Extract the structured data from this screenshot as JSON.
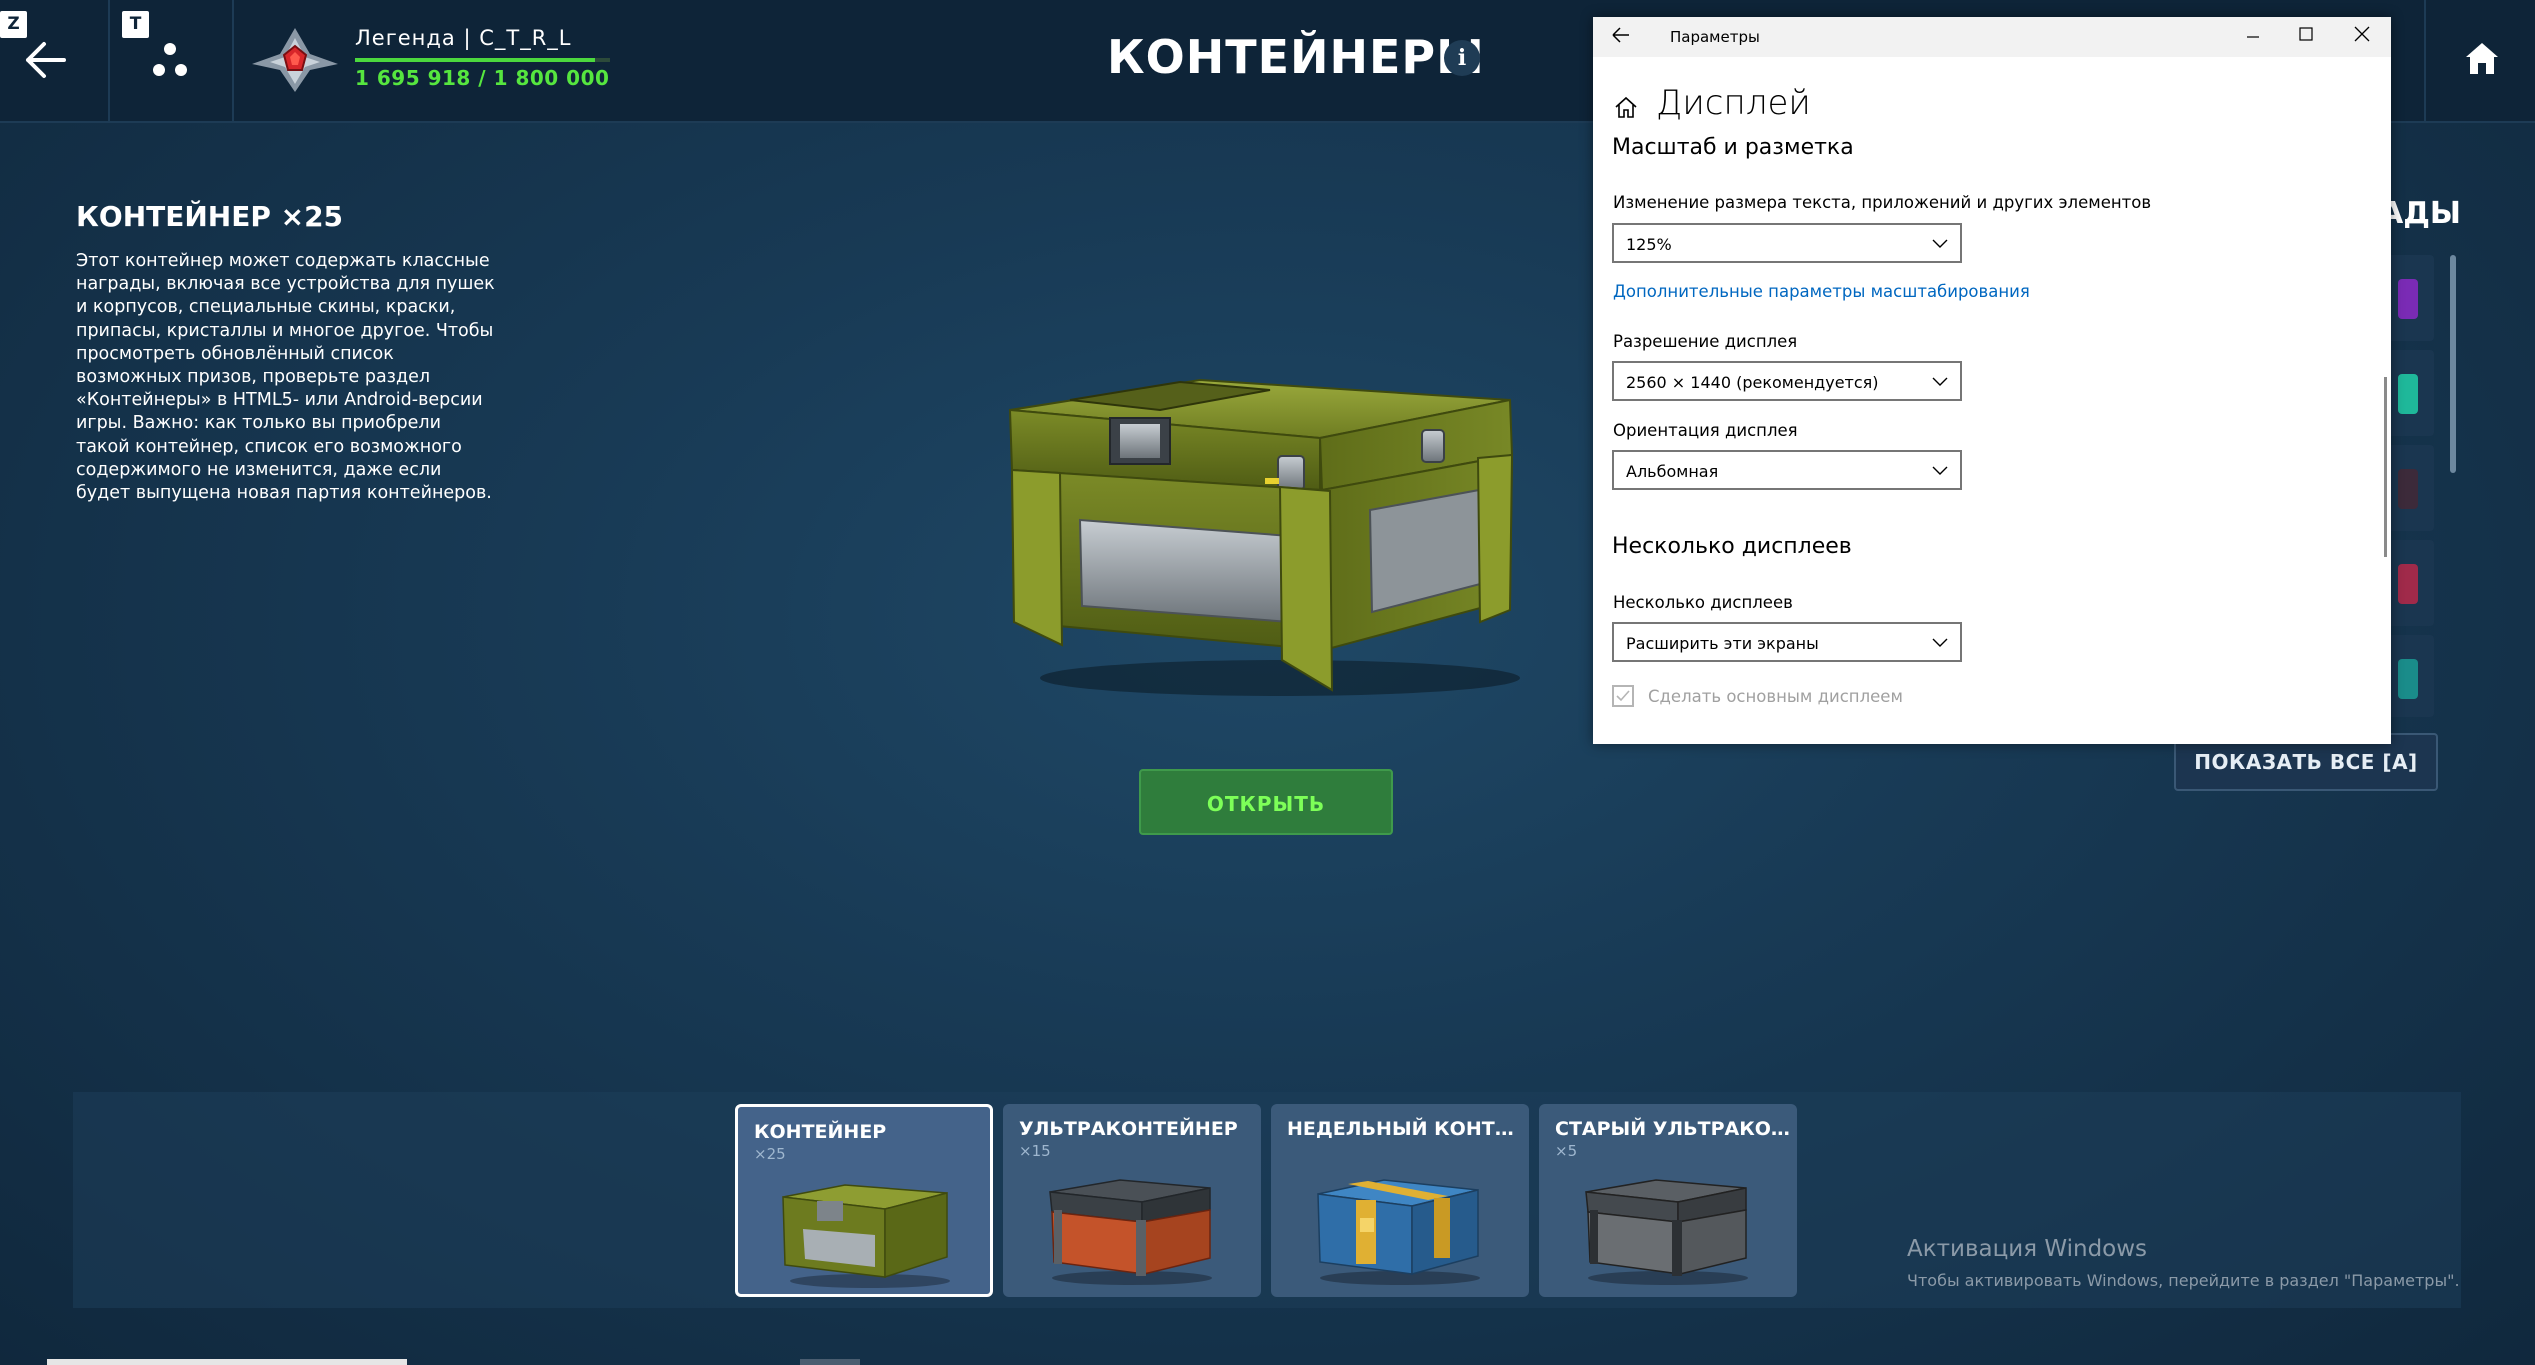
{
  "hotkeys": {
    "back": "Z",
    "social": "T"
  },
  "player": {
    "name": "Легенда | C_T_R_L",
    "xp_text": "1 695 918 / 1 800 000",
    "xp_current": 1695918,
    "xp_max": 1800000
  },
  "page": {
    "title": "КОНТЕЙНЕРЫ",
    "info": "i"
  },
  "container": {
    "title": "КОНТЕЙНЕР ×25",
    "description": "Этот контейнер может содержать классные награды, включая все устройства для пушек и корпусов, специальные скины, краски, припасы, кристаллы и многое другое. Чтобы просмотреть обновлённый список возможных призов, проверьте раздел «Контейнеры» в HTML5- или Android-версии игры. Важно: как только вы приобрели такой контейнер, список его возможного содержимого не изменится, даже если будет выпущена новая партия контейнеров.",
    "open_label": "ОТКРЫТЬ"
  },
  "rewards": {
    "title_visible": "АДЫ",
    "show_all_label": "ПОКАЗАТЬ ВСЕ [A]"
  },
  "cards": [
    {
      "name": "КОНТЕЙНЕР",
      "count": "×25",
      "selected": true
    },
    {
      "name": "УЛЬТРАКОНТЕЙНЕР",
      "count": "×15",
      "selected": false
    },
    {
      "name": "НЕДЕЛЬНЫЙ КОНТ…",
      "count": "",
      "selected": false
    },
    {
      "name": "СТАРЫЙ УЛЬТРАКО…",
      "count": "×5",
      "selected": false
    }
  ],
  "activation": {
    "title": "Активация Windows",
    "subtitle": "Чтобы активировать Windows, перейдите в раздел \"Параметры\"."
  },
  "settings": {
    "window_title": "Параметры",
    "heading": "Дисплей",
    "section_scale": "Масштаб и разметка",
    "scale_label": "Изменение размера текста, приложений и других элементов",
    "scale_value": "125%",
    "advanced_link": "Дополнительные параметры масштабирования",
    "resolution_label": "Разрешение дисплея",
    "resolution_value": "2560 × 1440 (рекомендуется)",
    "orientation_label": "Ориентация дисплея",
    "orientation_value": "Альбомная",
    "section_multi": "Несколько дисплеев",
    "multi_label": "Несколько дисплеев",
    "multi_value": "Расширить эти экраны",
    "main_display_label": "Сделать основным дисплеем"
  },
  "colors": {
    "background": "#183a55",
    "topbar": "#0e2438",
    "xp_green": "#56e63f",
    "open_button": "#2f7d3c",
    "link_blue": "#0067c0"
  }
}
